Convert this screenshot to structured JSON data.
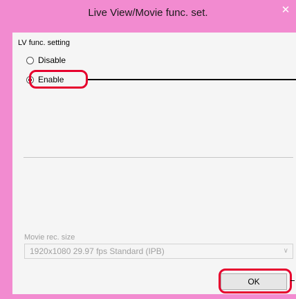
{
  "window": {
    "title": "Live View/Movie func. set.",
    "close_glyph": "✕",
    "frame_color": "#f28bd0"
  },
  "lv_func": {
    "section_label": "LV func. setting",
    "options": [
      {
        "label": "Disable",
        "selected": false
      },
      {
        "label": "Enable",
        "selected": true
      }
    ]
  },
  "movie": {
    "label": "Movie rec. size",
    "selected_value": "1920x1080  29.97 fps Standard (IPB)",
    "enabled": false
  },
  "buttons": {
    "ok_label": "OK"
  },
  "annotations": {
    "highlight_color": "#e6002d"
  },
  "icons": {
    "close": "close-icon",
    "dropdown": "chevron-down-icon"
  }
}
